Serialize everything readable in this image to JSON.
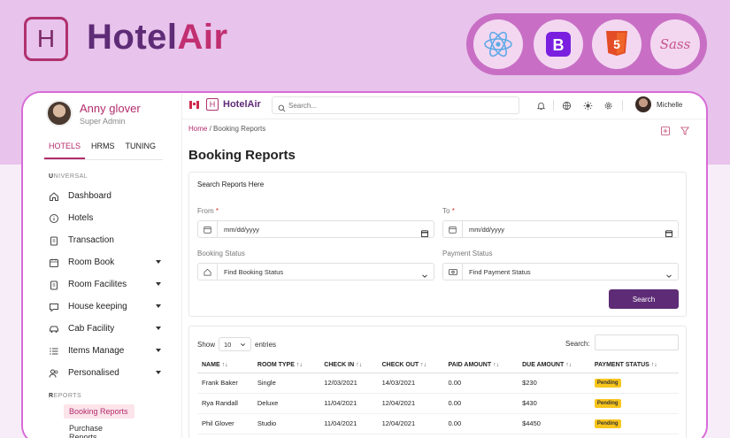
{
  "brand": {
    "name_part1": "Hotel",
    "name_part2": "Air",
    "logo_letter": "H"
  },
  "tech_icons": [
    "react-icon",
    "bootstrap-icon",
    "html5-icon",
    "sass-icon"
  ],
  "sidebar": {
    "user_name": "Anny glover",
    "user_role": "Super Admin",
    "tabs": [
      "HOTELS",
      "HRMS",
      "TUNING"
    ],
    "section_universal_first": "U",
    "section_universal_rest": "NIVERSAL",
    "items": [
      {
        "label": "Dashboard",
        "icon": "home-icon",
        "caret": false
      },
      {
        "label": "Hotels",
        "icon": "info-icon",
        "caret": false
      },
      {
        "label": "Transaction",
        "icon": "clipboard-icon",
        "caret": false
      },
      {
        "label": "Room Book",
        "icon": "calendar-icon",
        "caret": true
      },
      {
        "label": "Room Facilites",
        "icon": "clipboard-icon",
        "caret": true
      },
      {
        "label": "House keeping",
        "icon": "chat-icon",
        "caret": true
      },
      {
        "label": "Cab Facility",
        "icon": "car-icon",
        "caret": true
      },
      {
        "label": "Items Manage",
        "icon": "list-icon",
        "caret": true
      },
      {
        "label": "Personalised",
        "icon": "users-icon",
        "caret": true
      }
    ],
    "section_reports_first": "R",
    "section_reports_rest": "EPORTS",
    "sub_items": [
      "Booking Reports",
      "Purchase Reports"
    ]
  },
  "topbar": {
    "brand": "HotelAir",
    "logo_letter": "H",
    "search_placeholder": "Search...",
    "user_name": "Michelle"
  },
  "breadcrumb": {
    "home": "Home",
    "separator": "/",
    "current": "Booking Reports"
  },
  "page_title": "Booking Reports",
  "filters": {
    "card_title": "Search Reports Here",
    "from_label": "From",
    "to_label": "To",
    "required_mark": "*",
    "date_placeholder": "mm/dd/yyyy",
    "booking_status_label": "Booking Status",
    "booking_status_value": "Find Booking Status",
    "payment_status_label": "Payment Status",
    "payment_status_value": "Find Payment Status",
    "search_button": "Search"
  },
  "table": {
    "show_label": "Show",
    "entries_value": "10",
    "entries_label": "entries",
    "search_label": "Search:",
    "sort_glyph": "↑↓",
    "columns": [
      "NAME",
      "ROOM TYPE",
      "CHECK IN",
      "CHECK OUT",
      "PAID AMOUNT",
      "DUE AMOUNT",
      "PAYMENT STATUS"
    ],
    "rows": [
      {
        "name": "Frank Baker",
        "room_type": "Single",
        "check_in": "12/03/2021",
        "check_out": "14/03/2021",
        "paid": "0.00",
        "due": "$230",
        "status": "Pending"
      },
      {
        "name": "Rya Randall",
        "room_type": "Deluxe",
        "check_in": "11/04/2021",
        "check_out": "12/04/2021",
        "paid": "0.00",
        "due": "$430",
        "status": "Pending"
      },
      {
        "name": "Phil Glover",
        "room_type": "Studio",
        "check_in": "11/04/2021",
        "check_out": "12/04/2021",
        "paid": "0.00",
        "due": "$4450",
        "status": "Pending"
      }
    ]
  },
  "colors": {
    "brand_purple": "#5e2b76",
    "brand_pink": "#b32b6c",
    "badge_yellow": "#f8c51d"
  }
}
